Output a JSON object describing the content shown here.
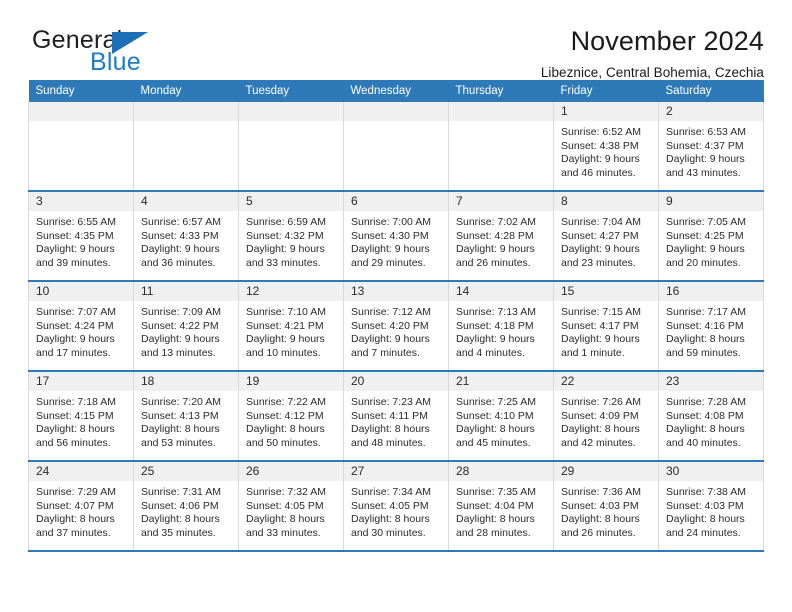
{
  "brand": {
    "name_part1": "General",
    "name_part2": "Blue",
    "logo_icon": "blue-triangle-icon"
  },
  "header": {
    "title": "November 2024",
    "subtitle": "Libeznice, Central Bohemia, Czechia"
  },
  "calendar": {
    "weekday_headers": [
      "Sunday",
      "Monday",
      "Tuesday",
      "Wednesday",
      "Thursday",
      "Friday",
      "Saturday"
    ],
    "accent_color": "#2e7ab8",
    "daynum_band_color": "#f0f0f0",
    "weeks": [
      [
        {
          "day": "",
          "empty": true
        },
        {
          "day": "",
          "empty": true
        },
        {
          "day": "",
          "empty": true
        },
        {
          "day": "",
          "empty": true
        },
        {
          "day": "",
          "empty": true
        },
        {
          "day": "1",
          "sunrise": "Sunrise: 6:52 AM",
          "sunset": "Sunset: 4:38 PM",
          "daylight": "Daylight: 9 hours and 46 minutes."
        },
        {
          "day": "2",
          "sunrise": "Sunrise: 6:53 AM",
          "sunset": "Sunset: 4:37 PM",
          "daylight": "Daylight: 9 hours and 43 minutes."
        }
      ],
      [
        {
          "day": "3",
          "sunrise": "Sunrise: 6:55 AM",
          "sunset": "Sunset: 4:35 PM",
          "daylight": "Daylight: 9 hours and 39 minutes."
        },
        {
          "day": "4",
          "sunrise": "Sunrise: 6:57 AM",
          "sunset": "Sunset: 4:33 PM",
          "daylight": "Daylight: 9 hours and 36 minutes."
        },
        {
          "day": "5",
          "sunrise": "Sunrise: 6:59 AM",
          "sunset": "Sunset: 4:32 PM",
          "daylight": "Daylight: 9 hours and 33 minutes."
        },
        {
          "day": "6",
          "sunrise": "Sunrise: 7:00 AM",
          "sunset": "Sunset: 4:30 PM",
          "daylight": "Daylight: 9 hours and 29 minutes."
        },
        {
          "day": "7",
          "sunrise": "Sunrise: 7:02 AM",
          "sunset": "Sunset: 4:28 PM",
          "daylight": "Daylight: 9 hours and 26 minutes."
        },
        {
          "day": "8",
          "sunrise": "Sunrise: 7:04 AM",
          "sunset": "Sunset: 4:27 PM",
          "daylight": "Daylight: 9 hours and 23 minutes."
        },
        {
          "day": "9",
          "sunrise": "Sunrise: 7:05 AM",
          "sunset": "Sunset: 4:25 PM",
          "daylight": "Daylight: 9 hours and 20 minutes."
        }
      ],
      [
        {
          "day": "10",
          "sunrise": "Sunrise: 7:07 AM",
          "sunset": "Sunset: 4:24 PM",
          "daylight": "Daylight: 9 hours and 17 minutes."
        },
        {
          "day": "11",
          "sunrise": "Sunrise: 7:09 AM",
          "sunset": "Sunset: 4:22 PM",
          "daylight": "Daylight: 9 hours and 13 minutes."
        },
        {
          "day": "12",
          "sunrise": "Sunrise: 7:10 AM",
          "sunset": "Sunset: 4:21 PM",
          "daylight": "Daylight: 9 hours and 10 minutes."
        },
        {
          "day": "13",
          "sunrise": "Sunrise: 7:12 AM",
          "sunset": "Sunset: 4:20 PM",
          "daylight": "Daylight: 9 hours and 7 minutes."
        },
        {
          "day": "14",
          "sunrise": "Sunrise: 7:13 AM",
          "sunset": "Sunset: 4:18 PM",
          "daylight": "Daylight: 9 hours and 4 minutes."
        },
        {
          "day": "15",
          "sunrise": "Sunrise: 7:15 AM",
          "sunset": "Sunset: 4:17 PM",
          "daylight": "Daylight: 9 hours and 1 minute."
        },
        {
          "day": "16",
          "sunrise": "Sunrise: 7:17 AM",
          "sunset": "Sunset: 4:16 PM",
          "daylight": "Daylight: 8 hours and 59 minutes."
        }
      ],
      [
        {
          "day": "17",
          "sunrise": "Sunrise: 7:18 AM",
          "sunset": "Sunset: 4:15 PM",
          "daylight": "Daylight: 8 hours and 56 minutes."
        },
        {
          "day": "18",
          "sunrise": "Sunrise: 7:20 AM",
          "sunset": "Sunset: 4:13 PM",
          "daylight": "Daylight: 8 hours and 53 minutes."
        },
        {
          "day": "19",
          "sunrise": "Sunrise: 7:22 AM",
          "sunset": "Sunset: 4:12 PM",
          "daylight": "Daylight: 8 hours and 50 minutes."
        },
        {
          "day": "20",
          "sunrise": "Sunrise: 7:23 AM",
          "sunset": "Sunset: 4:11 PM",
          "daylight": "Daylight: 8 hours and 48 minutes."
        },
        {
          "day": "21",
          "sunrise": "Sunrise: 7:25 AM",
          "sunset": "Sunset: 4:10 PM",
          "daylight": "Daylight: 8 hours and 45 minutes."
        },
        {
          "day": "22",
          "sunrise": "Sunrise: 7:26 AM",
          "sunset": "Sunset: 4:09 PM",
          "daylight": "Daylight: 8 hours and 42 minutes."
        },
        {
          "day": "23",
          "sunrise": "Sunrise: 7:28 AM",
          "sunset": "Sunset: 4:08 PM",
          "daylight": "Daylight: 8 hours and 40 minutes."
        }
      ],
      [
        {
          "day": "24",
          "sunrise": "Sunrise: 7:29 AM",
          "sunset": "Sunset: 4:07 PM",
          "daylight": "Daylight: 8 hours and 37 minutes."
        },
        {
          "day": "25",
          "sunrise": "Sunrise: 7:31 AM",
          "sunset": "Sunset: 4:06 PM",
          "daylight": "Daylight: 8 hours and 35 minutes."
        },
        {
          "day": "26",
          "sunrise": "Sunrise: 7:32 AM",
          "sunset": "Sunset: 4:05 PM",
          "daylight": "Daylight: 8 hours and 33 minutes."
        },
        {
          "day": "27",
          "sunrise": "Sunrise: 7:34 AM",
          "sunset": "Sunset: 4:05 PM",
          "daylight": "Daylight: 8 hours and 30 minutes."
        },
        {
          "day": "28",
          "sunrise": "Sunrise: 7:35 AM",
          "sunset": "Sunset: 4:04 PM",
          "daylight": "Daylight: 8 hours and 28 minutes."
        },
        {
          "day": "29",
          "sunrise": "Sunrise: 7:36 AM",
          "sunset": "Sunset: 4:03 PM",
          "daylight": "Daylight: 8 hours and 26 minutes."
        },
        {
          "day": "30",
          "sunrise": "Sunrise: 7:38 AM",
          "sunset": "Sunset: 4:03 PM",
          "daylight": "Daylight: 8 hours and 24 minutes."
        }
      ]
    ]
  }
}
